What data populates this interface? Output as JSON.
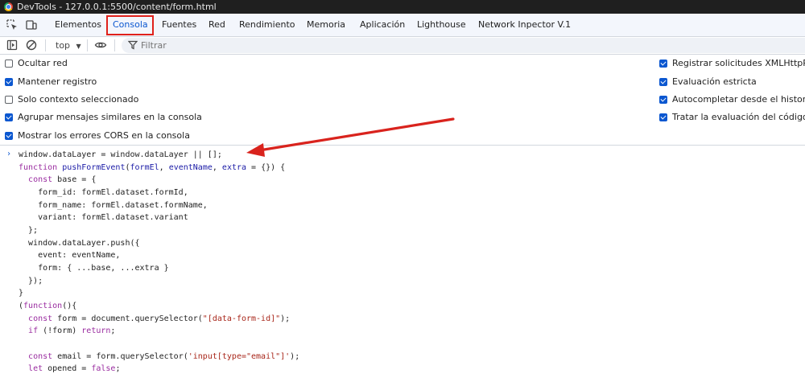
{
  "window": {
    "title": "DevTools - 127.0.0.1:5500/content/form.html"
  },
  "tabs": [
    {
      "label": "Elementos"
    },
    {
      "label": "Consola"
    },
    {
      "label": "Fuentes"
    },
    {
      "label": "Red"
    },
    {
      "label": "Rendimiento"
    },
    {
      "label": "Memoria"
    },
    {
      "label": "Aplicación"
    },
    {
      "label": "Lighthouse"
    },
    {
      "label": "Network Inpector V.1"
    }
  ],
  "active_tab": "Consola",
  "toolbar": {
    "context": "top",
    "filter_placeholder": "Filtrar"
  },
  "settings": {
    "left": [
      {
        "label": "Ocultar red",
        "checked": false
      },
      {
        "label": "Mantener registro",
        "checked": true
      },
      {
        "label": "Solo contexto seleccionado",
        "checked": false
      },
      {
        "label": "Agrupar mensajes similares en la consola",
        "checked": true
      },
      {
        "label": "Mostrar los errores CORS en la consola",
        "checked": true
      }
    ],
    "right": [
      {
        "label": "Registrar solicitudes XMLHttpReq",
        "checked": true
      },
      {
        "label": "Evaluación estricta",
        "checked": true
      },
      {
        "label": "Autocompletar desde el historial",
        "checked": true
      },
      {
        "label": "Tratar la evaluación del código co",
        "checked": true
      }
    ]
  },
  "console": {
    "prompt": "›",
    "code_lines": [
      "window.dataLayer = window.dataLayer || [];",
      "function pushFormEvent(formEl, eventName, extra = {}) {",
      "  const base = {",
      "    form_id: formEl.dataset.formId,",
      "    form_name: formEl.dataset.formName,",
      "    variant: formEl.dataset.variant",
      "  };",
      "  window.dataLayer.push({",
      "    event: eventName,",
      "    form: { ...base, ...extra }",
      "  });",
      "}",
      "(function(){",
      "  const form = document.querySelector(\"[data-form-id]\");",
      "  if (!form) return;",
      "",
      "  const email = form.querySelector('input[type=\"email\"]');",
      "  let opened = false;"
    ]
  },
  "colors": {
    "accent": "#0b57d0",
    "highlight_box": "#e0211b",
    "annotation_arrow": "#d9231d",
    "keyword": "#9a2ca0",
    "string": "#a8261a",
    "function_name": "#1a1aa6",
    "param": "#1a1aa6"
  }
}
